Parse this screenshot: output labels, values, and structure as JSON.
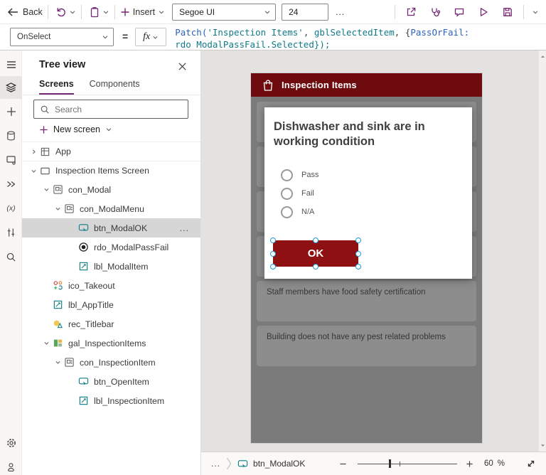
{
  "toolbar": {
    "back_label": "Back",
    "insert_label": "Insert",
    "font_name": "Segoe UI",
    "font_size": "24",
    "more": "...",
    "icons": [
      "back-arrow",
      "undo",
      "paste",
      "insert-plus",
      "share",
      "app-checker",
      "comments",
      "preview-play",
      "save"
    ]
  },
  "formula_bar": {
    "property": "OnSelect",
    "equals": "=",
    "fx_label": "fx",
    "segments": [
      {
        "text": "Patch(",
        "color": "#2a62bc"
      },
      {
        "text": "'Inspection Items'",
        "color": "#0f7b87"
      },
      {
        "text": ", ",
        "color": "#444444"
      },
      {
        "text": "gblSelectedItem",
        "color": "#0f7b87"
      },
      {
        "text": ", {",
        "color": "#444444"
      },
      {
        "text": "PassOrFail:",
        "color": "#2a62bc"
      }
    ],
    "line2": "rdo_ModalPassFail.Selected});"
  },
  "left_rail": {
    "items": [
      "menu",
      "tree-view",
      "insert",
      "data",
      "media",
      "power-automate",
      "variables",
      "advanced-tools",
      "search"
    ],
    "bottom_items": [
      "settings",
      "virtual-agent"
    ],
    "variables_glyph": "(x)"
  },
  "tree_view": {
    "title": "Tree view",
    "tabs": [
      {
        "label": "Screens",
        "active": true
      },
      {
        "label": "Components",
        "active": false
      }
    ],
    "search_placeholder": "Search",
    "new_screen": "New screen",
    "items": [
      {
        "label": "App",
        "icon": "app",
        "level": 0,
        "chevron": "collapsed"
      },
      {
        "label": "Inspection Items Screen",
        "icon": "screen",
        "level": 0,
        "chevron": "expanded"
      },
      {
        "label": "con_Modal",
        "icon": "container",
        "level": 1,
        "chevron": "expanded"
      },
      {
        "label": "con_ModalMenu",
        "icon": "container",
        "level": 2,
        "chevron": "expanded"
      },
      {
        "label": "btn_ModalOK",
        "icon": "button",
        "level": 3,
        "selected": true,
        "more": "..."
      },
      {
        "label": "rdo_ModalPassFail",
        "icon": "radio",
        "level": 3
      },
      {
        "label": "lbl_ModalItem",
        "icon": "label",
        "level": 3
      },
      {
        "label": "ico_Takeout",
        "icon": "icon",
        "level": 1
      },
      {
        "label": "lbl_AppTitle",
        "icon": "label",
        "level": 1
      },
      {
        "label": "rec_Titlebar",
        "icon": "shape",
        "level": 1
      },
      {
        "label": "gal_InspectionItems",
        "icon": "gallery",
        "level": 1,
        "chevron": "expanded"
      },
      {
        "label": "con_InspectionItem",
        "icon": "container",
        "level": 2,
        "chevron": "expanded"
      },
      {
        "label": "btn_OpenItem",
        "icon": "button",
        "level": 3
      },
      {
        "label": "lbl_InspectionItem",
        "icon": "label",
        "level": 3
      }
    ]
  },
  "canvas": {
    "app_preview": {
      "header_title": "Inspection Items",
      "modal": {
        "question": "Dishwasher and sink are in working condition",
        "options": [
          "Pass",
          "Fail",
          "N/A"
        ],
        "ok_label": "OK"
      },
      "gallery_visible_items": [
        "Staff members have food safety certification",
        "Building does not have any pest related problems"
      ]
    }
  },
  "status_bar": {
    "more": "...",
    "selected_control": "btn_ModalOK",
    "zoom_value": "60",
    "percent_sign": "%"
  },
  "colors": {
    "accent_purple": "#742774",
    "header_red": "#6e0b0e",
    "button_red": "#8f1013",
    "selection_blue": "#1d9ad6",
    "canvas_dim": "#7b7b7b",
    "card_gray": "#8d8d8d"
  }
}
